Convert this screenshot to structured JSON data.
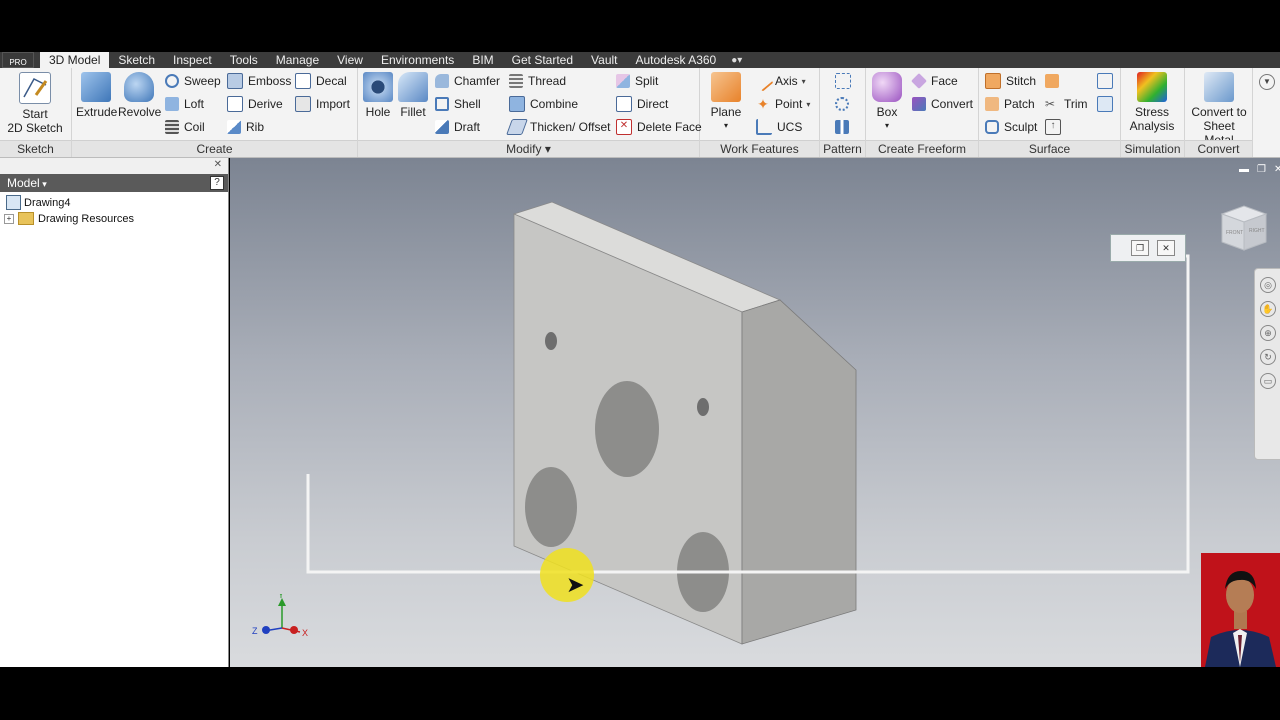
{
  "app": {
    "edition_badge": "PRO"
  },
  "menu": {
    "tabs": [
      "3D Model",
      "Sketch",
      "Inspect",
      "Tools",
      "Manage",
      "View",
      "Environments",
      "BIM",
      "Get Started",
      "Vault",
      "Autodesk A360"
    ],
    "active_tab": "3D Model"
  },
  "ribbon": {
    "sketch": {
      "title": "Sketch",
      "start_sketch": "Start\n2D Sketch"
    },
    "create": {
      "title": "Create",
      "extrude": "Extrude",
      "revolve": "Revolve",
      "sweep": "Sweep",
      "loft": "Loft",
      "coil": "Coil",
      "emboss": "Emboss",
      "derive": "Derive",
      "rib": "Rib",
      "decal": "Decal",
      "import": "Import"
    },
    "modify": {
      "title": "Modify",
      "hole": "Hole",
      "fillet": "Fillet",
      "chamfer": "Chamfer",
      "shell": "Shell",
      "draft": "Draft",
      "thread": "Thread",
      "combine": "Combine",
      "thicken_offset": "Thicken/ Offset",
      "split": "Split",
      "direct": "Direct",
      "delete_face": "Delete Face"
    },
    "work_features": {
      "title": "Work Features",
      "plane": "Plane",
      "axis": "Axis",
      "point": "Point",
      "ucs": "UCS"
    },
    "pattern": {
      "title": "Pattern"
    },
    "create_freeform": {
      "title": "Create Freeform",
      "box": "Box",
      "face": "Face",
      "convert": "Convert"
    },
    "surface": {
      "title": "Surface",
      "stitch": "Stitch",
      "patch": "Patch",
      "sculpt": "Sculpt",
      "trim": "Trim"
    },
    "simulation": {
      "title": "Simulation",
      "stress_analysis": "Stress\nAnalysis"
    },
    "convert": {
      "title": "Convert",
      "convert_to_sheet_metal": "Convert to\nSheet Metal"
    }
  },
  "browser": {
    "title": "Model",
    "root": "Drawing4",
    "children": [
      "Drawing Resources"
    ]
  },
  "viewport": {
    "viewcube_faces": [
      "FRONT",
      "RIGHT"
    ],
    "axes": [
      "Z",
      "Y",
      "X"
    ]
  },
  "colors": {
    "ribbon_bg": "#f3f3f3",
    "tab_bar": "#3b3b3b",
    "browser_header": "#5a5a5a",
    "part_face_light": "#c8c8c6",
    "part_face_dark": "#a6a6a4",
    "cursor_highlight": "#f0e11e"
  }
}
